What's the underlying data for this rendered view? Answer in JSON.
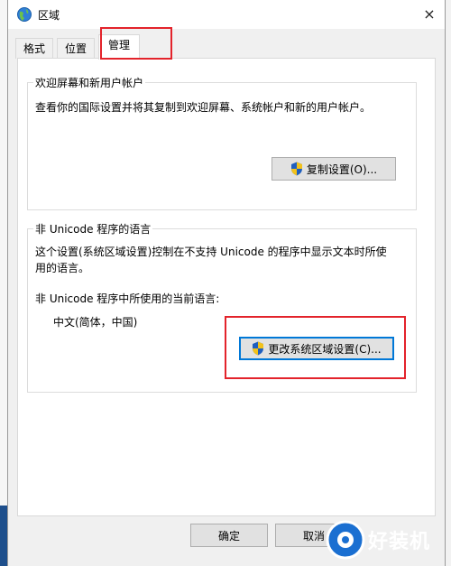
{
  "window": {
    "title": "区域",
    "close_glyph": "×"
  },
  "tabs": [
    {
      "label": "格式"
    },
    {
      "label": "位置"
    },
    {
      "label": "管理",
      "selected": true
    }
  ],
  "welcome_group": {
    "legend": "欢迎屏幕和新用户帐户",
    "description": "查看你的国际设置并将其复制到欢迎屏幕、系统帐户和新的用户帐户。",
    "copy_button": "复制设置(O)..."
  },
  "unicode_group": {
    "legend": "非 Unicode 程序的语言",
    "description_line1": "这个设置(系统区域设置)控制在不支持 Unicode 的程序中显示文本时所使",
    "description_line2": "用的语言。",
    "current_label": "非 Unicode 程序中所使用的当前语言:",
    "current_value": "中文(简体，中国)",
    "change_button": "更改系统区域设置(C)..."
  },
  "footer": {
    "ok": "确定",
    "cancel": "取消"
  },
  "watermark": {
    "text": "好装机"
  },
  "colors": {
    "highlight": "#e3232b",
    "accent": "#0078d7"
  }
}
